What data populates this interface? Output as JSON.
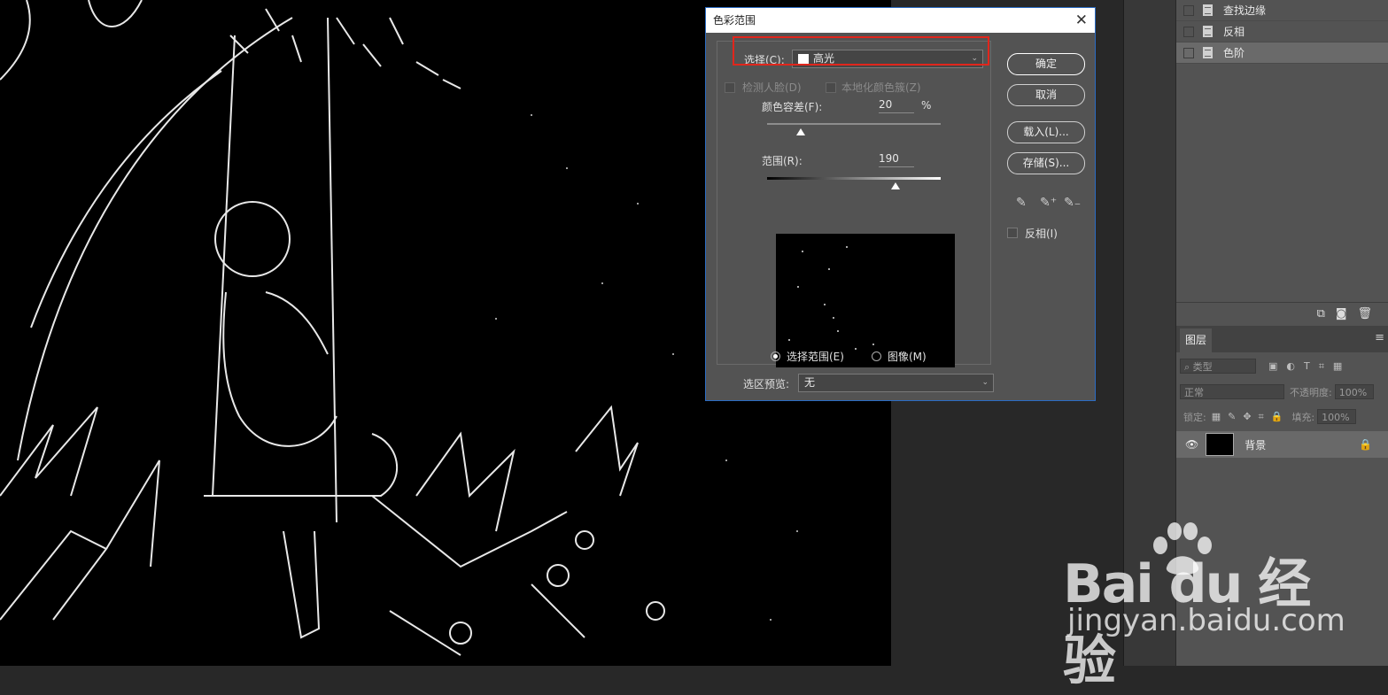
{
  "history": {
    "items": [
      {
        "label": "查找边缘"
      },
      {
        "label": "反相"
      },
      {
        "label": "色阶"
      }
    ],
    "footer_icons": [
      "new-snapshot-icon",
      "camera-icon",
      "trash-icon"
    ]
  },
  "layers_panel": {
    "tab": "图层",
    "menu_icon": "≡",
    "filter_label": "类型",
    "blend_mode": "正常",
    "opacity_label": "不透明度:",
    "opacity_value": "100%",
    "lock_label": "锁定:",
    "fill_label": "填充:",
    "fill_value": "100%",
    "layer_name": "背景"
  },
  "dialog": {
    "title": "色彩范围",
    "close": "✕",
    "select_label": "选择(C):",
    "select_value": "高光",
    "detect_faces": "检测人脸(D)",
    "localized": "本地化颜色簇(Z)",
    "fuzziness_label": "颜色容差(F):",
    "fuzziness_value": "20",
    "percent": "%",
    "range_label": "范围(R):",
    "range_value": "190",
    "radio_selection": "选择范围(E)",
    "radio_image": "图像(M)",
    "preview_label": "选区预览:",
    "preview_value": "无",
    "ok": "确定",
    "cancel": "取消",
    "load": "载入(L)...",
    "save": "存储(S)...",
    "invert": "反相(I)"
  },
  "watermark": {
    "brand": "Bai du 经验",
    "url": "jingyan.baidu.com"
  }
}
